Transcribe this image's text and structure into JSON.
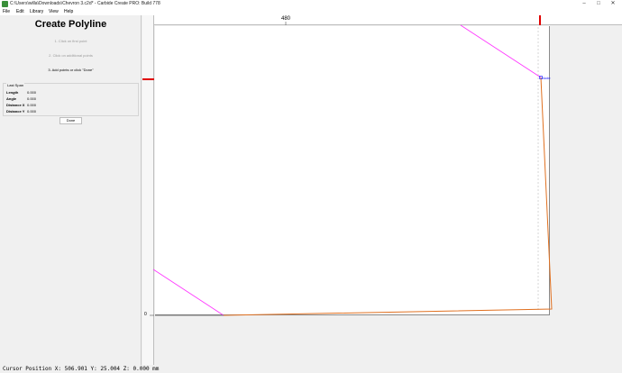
{
  "window": {
    "title": "C:\\Users\\willa\\Downloads\\Chevron 3.c2d* - Carbide Create PRO: Build 778",
    "minimize_icon": "minimize-icon",
    "maximize_icon": "maximize-icon",
    "close_icon": "close-icon"
  },
  "menu": {
    "items": [
      "File",
      "Edit",
      "Library",
      "View",
      "Help"
    ]
  },
  "panel": {
    "title": "Create Polyline",
    "steps": [
      "1. Click on first point",
      "2. Click on additional points",
      "3. Add points or click \"Done\""
    ],
    "last_span": {
      "legend": "Last Span",
      "rows": [
        {
          "label": "Length",
          "value": "0.000"
        },
        {
          "label": "Angle",
          "value": "0.000"
        },
        {
          "label": "Distance X",
          "value": "0.000"
        },
        {
          "label": "Distance Y",
          "value": "0.000"
        }
      ]
    },
    "done_label": "Done"
  },
  "rulers": {
    "top_label": "480",
    "left_label": "0"
  },
  "canvas": {
    "node_label": "Node"
  },
  "status": {
    "text": "Cursor Position X: 506.901 Y: 25.004 Z: 0.000 mm"
  },
  "colors": {
    "polyline": "#e07020",
    "guide": "#ff33ff",
    "marker": "#e00000",
    "node": "#1010ff"
  }
}
